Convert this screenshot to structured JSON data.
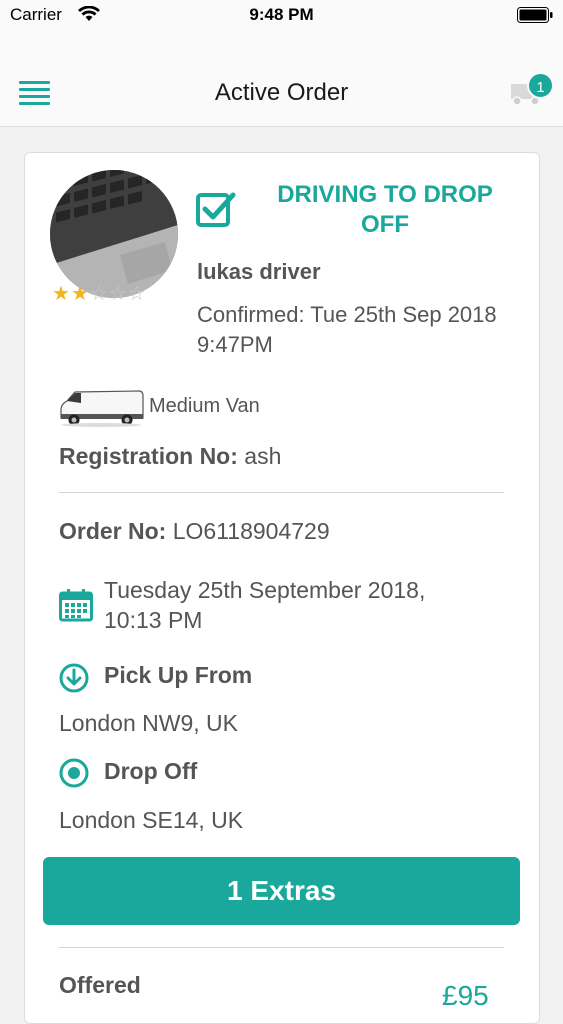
{
  "status_bar": {
    "carrier": "Carrier",
    "time": "9:48 PM"
  },
  "nav": {
    "title": "Active Order",
    "badge_count": "1"
  },
  "driver": {
    "status": "DRIVING TO DROP OFF",
    "name": "lukas driver",
    "rating": 2,
    "rating_max": 5,
    "confirmed": "Confirmed: Tue 25th Sep 2018 9:47PM"
  },
  "vehicle": {
    "type": "Medium Van",
    "registration_label": "Registration No:",
    "registration_value": "ash"
  },
  "order": {
    "number_label": "Order No:",
    "number_value": "LO6118904729",
    "date": "Tuesday 25th September 2018, 10:13 PM",
    "pickup_label": "Pick Up From",
    "pickup_address": "London NW9, UK",
    "dropoff_label": "Drop Off",
    "dropoff_address": "London SE14, UK"
  },
  "extras_button": "1 Extras",
  "offered": {
    "label": "Offered",
    "price": "£95"
  },
  "colors": {
    "accent": "#19a89b",
    "star": "#f3b51d"
  }
}
